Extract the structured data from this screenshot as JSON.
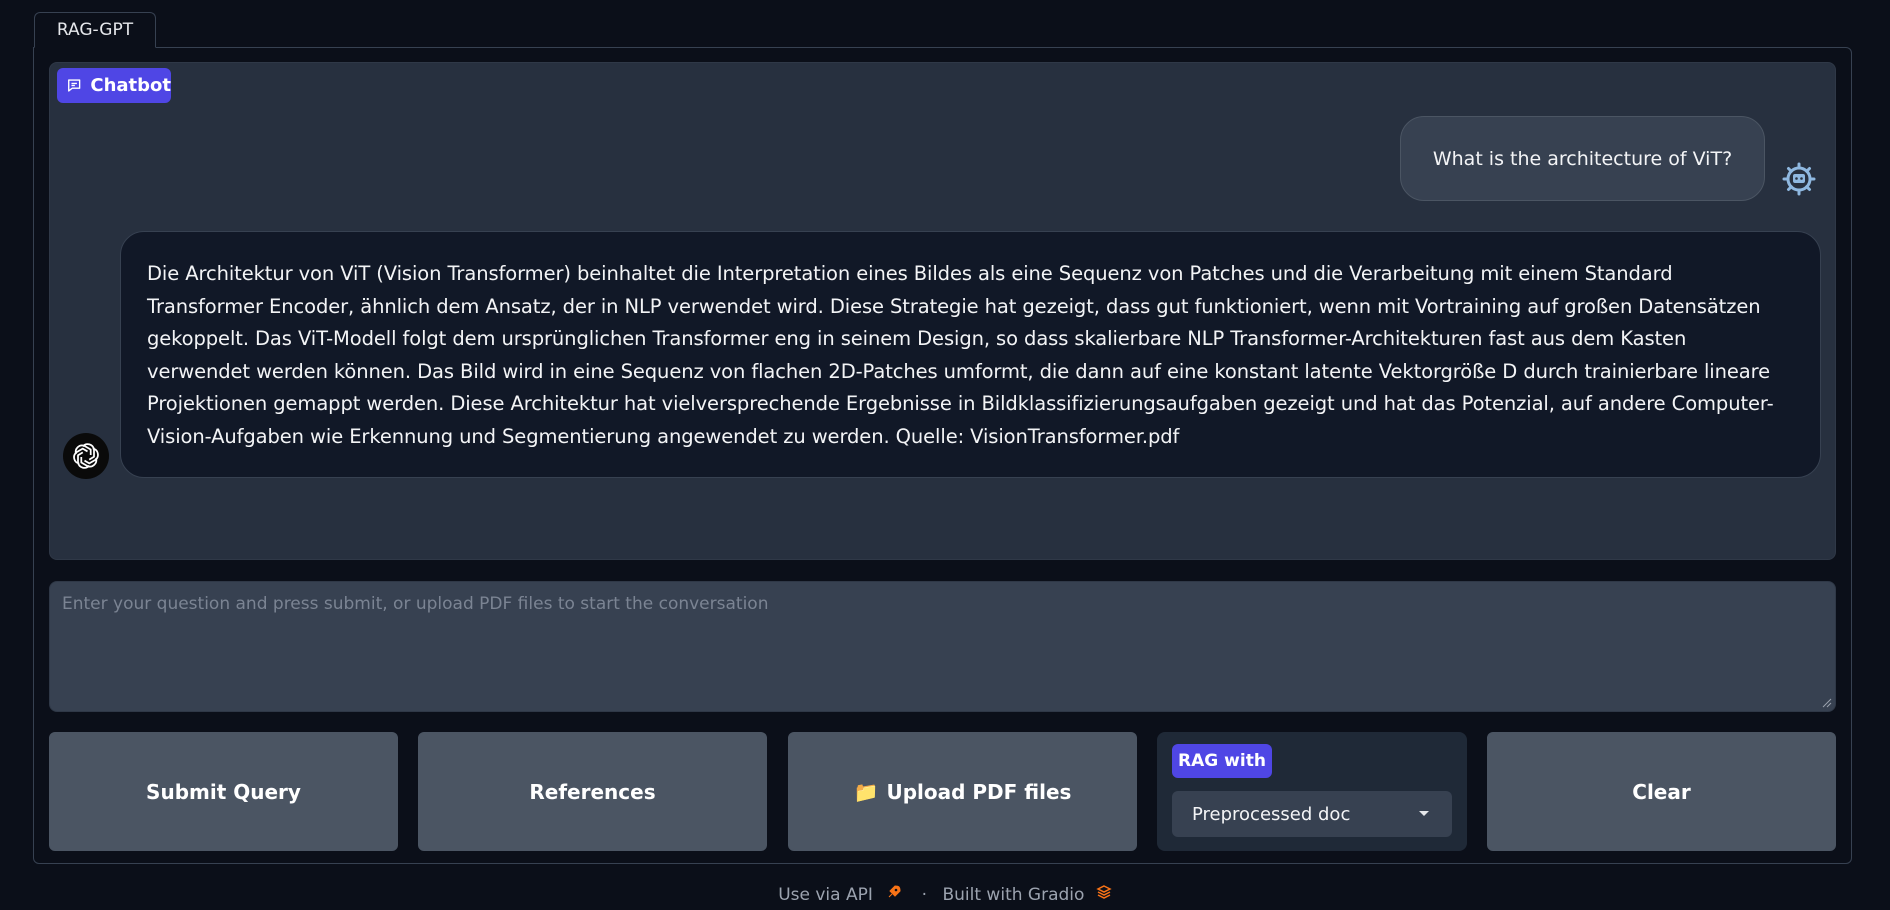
{
  "tab": {
    "label": "RAG-GPT"
  },
  "chatbot": {
    "label": "Chatbot",
    "messages": [
      {
        "role": "user",
        "text": "What is the architecture of ViT?"
      },
      {
        "role": "assistant",
        "text": "Die Architektur von ViT (Vision Transformer) beinhaltet die Interpretation eines Bildes als eine Sequenz von Patches und die Verarbeitung mit einem Standard Transformer Encoder, ähnlich dem Ansatz, der in NLP verwendet wird. Diese Strategie hat gezeigt, dass gut funktioniert, wenn mit Vortraining auf großen Datensätzen gekoppelt. Das ViT-Modell folgt dem ursprünglichen Transformer eng in seinem Design, so dass skalierbare NLP Transformer-Architekturen fast aus dem Kasten verwendet werden können. Das Bild wird in eine Sequenz von flachen 2D-Patches umformt, die dann auf eine konstant latente Vektorgröße D durch trainierbare lineare Projektionen gemappt werden. Diese Architektur hat vielversprechende Ergebnisse in Bildklassifizierungsaufgaben gezeigt und hat das Potenzial, auf andere Computer-Vision-Aufgaben wie Erkennung und Segmentierung angewendet zu werden. Quelle: VisionTransformer.pdf"
      }
    ]
  },
  "input": {
    "value": "",
    "placeholder": "Enter your question and press submit, or upload PDF files to start the conversation"
  },
  "buttons": {
    "submit": "Submit Query",
    "references": "References",
    "upload": "Upload PDF files",
    "upload_icon": "📁",
    "clear": "Clear"
  },
  "rag": {
    "label": "RAG with",
    "selected": "Preprocessed doc"
  },
  "footer": {
    "api": "Use via API",
    "separator": "·",
    "built": "Built with Gradio"
  },
  "colors": {
    "background": "#0b0f19",
    "accent": "#4f46e5",
    "button": "#4b5563",
    "chat_bg": "#27303f"
  }
}
